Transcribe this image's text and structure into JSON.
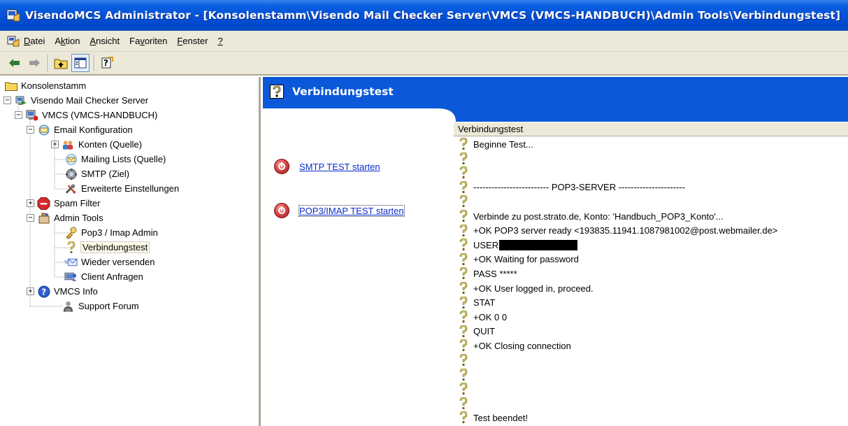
{
  "window": {
    "title": "VisendoMCS Administrator - [Konsolenstamm\\Visendo Mail Checker Server\\VMCS (VMCS-HANDBUCH)\\Admin Tools\\Verbindungstest]"
  },
  "menubar": {
    "items": [
      {
        "label": "Datei",
        "underline": "D"
      },
      {
        "label": "Aktion",
        "underline": "k"
      },
      {
        "label": "Ansicht",
        "underline": "A"
      },
      {
        "label": "Favoriten",
        "underline": "v"
      },
      {
        "label": "Fenster",
        "underline": "F"
      },
      {
        "label": "?",
        "underline": "?"
      }
    ]
  },
  "toolbar": {
    "buttons": [
      "back-arrow-icon",
      "forward-arrow-icon",
      "up-folder-icon",
      "show-hide-tree-icon",
      "help-icon"
    ]
  },
  "tree": {
    "items": [
      {
        "label": "Konsolenstamm",
        "icon": "folder-icon"
      },
      {
        "label": "Visendo Mail Checker Server",
        "icon": "server-icon",
        "expander": "−"
      },
      {
        "label": "VMCS (VMCS-HANDBUCH)",
        "icon": "computer-icon",
        "expander": "−"
      },
      {
        "label": "Email Konfiguration",
        "icon": "email-config-icon",
        "expander": "−"
      },
      {
        "label": "Konten (Quelle)",
        "icon": "users-icon",
        "expander": "+"
      },
      {
        "label": "Mailing Lists (Quelle)",
        "icon": "mailing-list-icon"
      },
      {
        "label": "SMTP (Ziel)",
        "icon": "smtp-icon"
      },
      {
        "label": "Erweiterte Einstellungen",
        "icon": "tools-icon"
      },
      {
        "label": "Spam Filter",
        "icon": "spam-filter-icon",
        "expander": "+"
      },
      {
        "label": "Admin Tools",
        "icon": "admin-tools-icon",
        "expander": "−"
      },
      {
        "label": "Pop3 / Imap Admin",
        "icon": "key-icon"
      },
      {
        "label": "Verbindungstest",
        "icon": "question-icon",
        "selected": true
      },
      {
        "label": "Wieder versenden",
        "icon": "resend-icon"
      },
      {
        "label": "Client Anfragen",
        "icon": "client-icon"
      },
      {
        "label": "VMCS Info",
        "icon": "info-icon",
        "expander": "+"
      },
      {
        "label": "Support Forum",
        "icon": "forum-icon"
      }
    ]
  },
  "content": {
    "title": "Verbindungstest",
    "actions": [
      {
        "label": "SMTP TEST starten"
      },
      {
        "label": "POP3/IMAP TEST starten"
      }
    ],
    "log": {
      "header": "Verbindungstest",
      "rows": [
        "Beginne Test...",
        "",
        "",
        "------------------------- POP3-SERVER ----------------------",
        "",
        "Verbinde zu post.strato.de, Konto: 'Handbuch_POP3_Konto'...",
        "+OK POP3 server ready <193835.11941.1087981002@post.webmailer.de>",
        "USER",
        "+OK Waiting for password",
        "PASS *****",
        "+OK User logged in, proceed.",
        "STAT",
        "+OK 0 0",
        "QUIT",
        "+OK Closing connection",
        "",
        "",
        "",
        "",
        "Test beendet!"
      ]
    }
  },
  "colors": {
    "titlebar": "#0450d6",
    "header": "#0b58d8",
    "chrome": "#ece9d8",
    "link": "#0b2ccc"
  }
}
